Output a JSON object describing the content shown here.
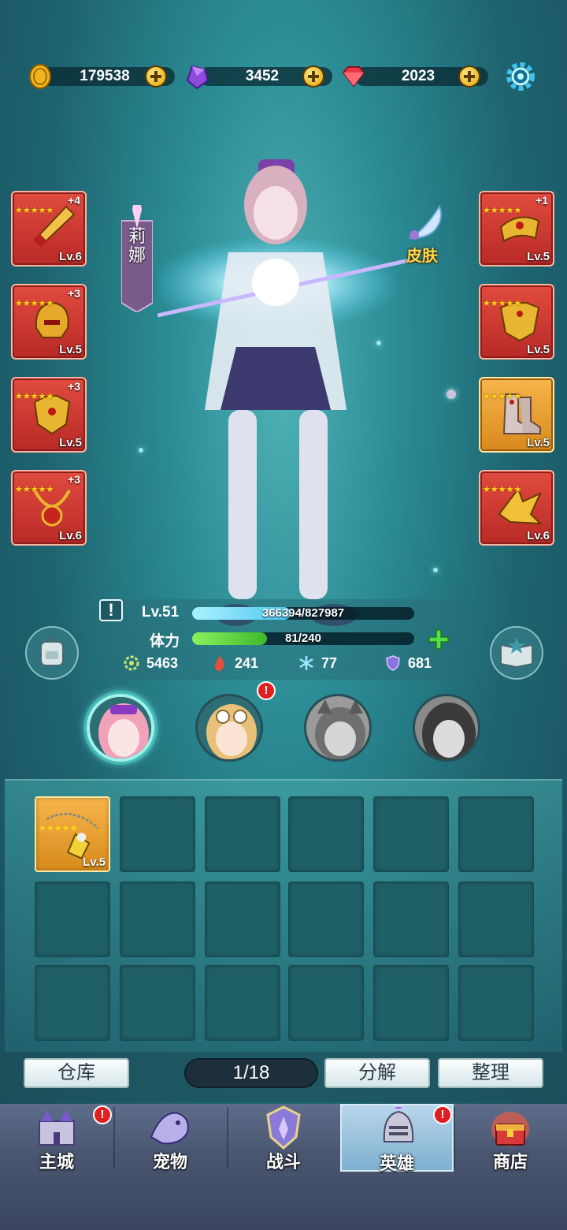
{
  "currencies": [
    {
      "name": "gold-coin",
      "value": "179538"
    },
    {
      "name": "purple-gem",
      "value": "3452"
    },
    {
      "name": "red-diamond",
      "value": "2023"
    }
  ],
  "hero": {
    "name": "莉娜",
    "skin_label": "皮肤"
  },
  "left_equipment": [
    {
      "item": "sword",
      "plus": "+4",
      "level": "Lv.6",
      "stars": 5
    },
    {
      "item": "helmet",
      "plus": "+3",
      "level": "Lv.5",
      "stars": 5
    },
    {
      "item": "armor",
      "plus": "+3",
      "level": "Lv.5",
      "stars": 5
    },
    {
      "item": "necklace",
      "plus": "+3",
      "level": "Lv.6",
      "stars": 5
    }
  ],
  "right_equipment": [
    {
      "item": "bracer",
      "plus": "+1",
      "level": "Lv.5",
      "stars": 5
    },
    {
      "item": "chest-plate",
      "plus": "",
      "level": "Lv.5",
      "stars": 5
    },
    {
      "item": "boots",
      "plus": "",
      "level": "Lv.5",
      "stars": 5
    },
    {
      "item": "wing-piece",
      "plus": "",
      "level": "Lv.6",
      "stars": 5
    }
  ],
  "stats": {
    "level": "Lv.51",
    "exp_text": "366394/827987",
    "exp_fraction": 0.4425,
    "stamina_label": "体力",
    "stamina_text": "81/240",
    "stamina_fraction": 0.3375,
    "power": "5463",
    "attack": "241",
    "ice": "77",
    "defense": "681"
  },
  "avatars": [
    {
      "name": "pink-hair-hero",
      "selected": true
    },
    {
      "name": "blonde-goggles-hero",
      "alert": "!"
    },
    {
      "name": "cat-ear-hero"
    },
    {
      "name": "dark-hair-hero"
    }
  ],
  "inventory": {
    "items": [
      {
        "item": "amulet",
        "level": "Lv.5",
        "stars": 5
      }
    ],
    "page": "1/18",
    "warehouse_label": "仓库",
    "decompose_label": "分解",
    "sort_label": "整理"
  },
  "nav": [
    {
      "label": "主城",
      "alert": "!"
    },
    {
      "label": "宠物"
    },
    {
      "label": "战斗"
    },
    {
      "label": "英雄",
      "active": true,
      "alert": "!"
    },
    {
      "label": "商店"
    }
  ],
  "colors": {
    "exp_bar": "#6fd6f5",
    "stamina_bar": "#5ccf3a",
    "equip_red": "#d23a33",
    "equip_gold": "#e99f2e"
  }
}
